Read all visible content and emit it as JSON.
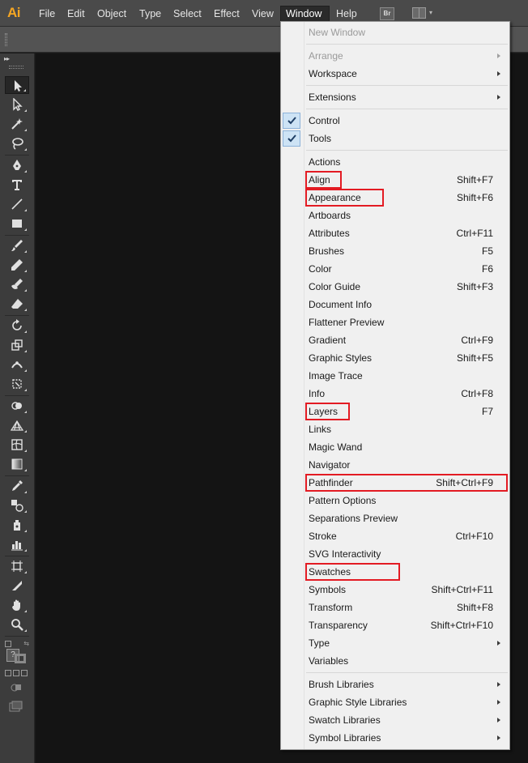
{
  "app": {
    "logo_text": "Ai"
  },
  "menubar": {
    "items": [
      "File",
      "Edit",
      "Object",
      "Type",
      "Select",
      "Effect",
      "View",
      "Window",
      "Help"
    ],
    "active": "Window",
    "bridge_label": "Br"
  },
  "tools": {
    "collapse_label": "▸▸",
    "items": [
      "selection-tool-icon",
      "direct-selection-tool-icon",
      "magic-wand-tool-icon",
      "lasso-tool-icon",
      "pen-tool-icon",
      "type-tool-icon",
      "line-segment-tool-icon",
      "rectangle-tool-icon",
      "paintbrush-tool-icon",
      "pencil-tool-icon",
      "blob-brush-tool-icon",
      "eraser-tool-icon",
      "rotate-tool-icon",
      "scale-tool-icon",
      "width-tool-icon",
      "free-transform-tool-icon",
      "shape-builder-tool-icon",
      "perspective-grid-tool-icon",
      "mesh-tool-icon",
      "gradient-tool-icon",
      "eyedropper-tool-icon",
      "blend-tool-icon",
      "symbol-sprayer-tool-icon",
      "column-graph-tool-icon",
      "artboard-tool-icon",
      "slice-tool-icon",
      "hand-tool-icon",
      "zoom-tool-icon"
    ],
    "fill_stroke_label": "?"
  },
  "window_menu": {
    "accent_check": "#8db2d9",
    "highlight_color": "#e31b23",
    "items": [
      {
        "label": "New Window",
        "shortcut": "",
        "submenu": false,
        "checked": false,
        "disabled": true,
        "highlighted": false
      },
      {
        "sep": true
      },
      {
        "label": "Arrange",
        "shortcut": "",
        "submenu": true,
        "checked": false,
        "disabled": true,
        "highlighted": false
      },
      {
        "label": "Workspace",
        "shortcut": "",
        "submenu": true,
        "checked": false,
        "disabled": false,
        "highlighted": false
      },
      {
        "sep": true
      },
      {
        "label": "Extensions",
        "shortcut": "",
        "submenu": true,
        "checked": false,
        "disabled": false,
        "highlighted": false
      },
      {
        "sep": true
      },
      {
        "label": "Control",
        "shortcut": "",
        "submenu": false,
        "checked": true,
        "disabled": false,
        "highlighted": false
      },
      {
        "label": "Tools",
        "shortcut": "",
        "submenu": false,
        "checked": true,
        "disabled": false,
        "highlighted": false
      },
      {
        "sep": true
      },
      {
        "label": "Actions",
        "shortcut": "",
        "submenu": false,
        "checked": false,
        "disabled": false,
        "highlighted": false
      },
      {
        "label": "Align",
        "shortcut": "Shift+F7",
        "submenu": false,
        "checked": false,
        "disabled": false,
        "highlighted": true
      },
      {
        "label": "Appearance",
        "shortcut": "Shift+F6",
        "submenu": false,
        "checked": false,
        "disabled": false,
        "highlighted": true
      },
      {
        "label": "Artboards",
        "shortcut": "",
        "submenu": false,
        "checked": false,
        "disabled": false,
        "highlighted": false
      },
      {
        "label": "Attributes",
        "shortcut": "Ctrl+F11",
        "submenu": false,
        "checked": false,
        "disabled": false,
        "highlighted": false
      },
      {
        "label": "Brushes",
        "shortcut": "F5",
        "submenu": false,
        "checked": false,
        "disabled": false,
        "highlighted": false
      },
      {
        "label": "Color",
        "shortcut": "F6",
        "submenu": false,
        "checked": false,
        "disabled": false,
        "highlighted": false
      },
      {
        "label": "Color Guide",
        "shortcut": "Shift+F3",
        "submenu": false,
        "checked": false,
        "disabled": false,
        "highlighted": false
      },
      {
        "label": "Document Info",
        "shortcut": "",
        "submenu": false,
        "checked": false,
        "disabled": false,
        "highlighted": false
      },
      {
        "label": "Flattener Preview",
        "shortcut": "",
        "submenu": false,
        "checked": false,
        "disabled": false,
        "highlighted": false
      },
      {
        "label": "Gradient",
        "shortcut": "Ctrl+F9",
        "submenu": false,
        "checked": false,
        "disabled": false,
        "highlighted": false
      },
      {
        "label": "Graphic Styles",
        "shortcut": "Shift+F5",
        "submenu": false,
        "checked": false,
        "disabled": false,
        "highlighted": false
      },
      {
        "label": "Image Trace",
        "shortcut": "",
        "submenu": false,
        "checked": false,
        "disabled": false,
        "highlighted": false
      },
      {
        "label": "Info",
        "shortcut": "Ctrl+F8",
        "submenu": false,
        "checked": false,
        "disabled": false,
        "highlighted": false
      },
      {
        "label": "Layers",
        "shortcut": "F7",
        "submenu": false,
        "checked": false,
        "disabled": false,
        "highlighted": true
      },
      {
        "label": "Links",
        "shortcut": "",
        "submenu": false,
        "checked": false,
        "disabled": false,
        "highlighted": false
      },
      {
        "label": "Magic Wand",
        "shortcut": "",
        "submenu": false,
        "checked": false,
        "disabled": false,
        "highlighted": false
      },
      {
        "label": "Navigator",
        "shortcut": "",
        "submenu": false,
        "checked": false,
        "disabled": false,
        "highlighted": false
      },
      {
        "label": "Pathfinder",
        "shortcut": "Shift+Ctrl+F9",
        "submenu": false,
        "checked": false,
        "disabled": false,
        "highlighted": true
      },
      {
        "label": "Pattern Options",
        "shortcut": "",
        "submenu": false,
        "checked": false,
        "disabled": false,
        "highlighted": false
      },
      {
        "label": "Separations Preview",
        "shortcut": "",
        "submenu": false,
        "checked": false,
        "disabled": false,
        "highlighted": false
      },
      {
        "label": "Stroke",
        "shortcut": "Ctrl+F10",
        "submenu": false,
        "checked": false,
        "disabled": false,
        "highlighted": false
      },
      {
        "label": "SVG Interactivity",
        "shortcut": "",
        "submenu": false,
        "checked": false,
        "disabled": false,
        "highlighted": false
      },
      {
        "label": "Swatches",
        "shortcut": "",
        "submenu": false,
        "checked": false,
        "disabled": false,
        "highlighted": true
      },
      {
        "label": "Symbols",
        "shortcut": "Shift+Ctrl+F11",
        "submenu": false,
        "checked": false,
        "disabled": false,
        "highlighted": false
      },
      {
        "label": "Transform",
        "shortcut": "Shift+F8",
        "submenu": false,
        "checked": false,
        "disabled": false,
        "highlighted": false
      },
      {
        "label": "Transparency",
        "shortcut": "Shift+Ctrl+F10",
        "submenu": false,
        "checked": false,
        "disabled": false,
        "highlighted": false
      },
      {
        "label": "Type",
        "shortcut": "",
        "submenu": true,
        "checked": false,
        "disabled": false,
        "highlighted": false
      },
      {
        "label": "Variables",
        "shortcut": "",
        "submenu": false,
        "checked": false,
        "disabled": false,
        "highlighted": false
      },
      {
        "sep": true
      },
      {
        "label": "Brush Libraries",
        "shortcut": "",
        "submenu": true,
        "checked": false,
        "disabled": false,
        "highlighted": false
      },
      {
        "label": "Graphic Style Libraries",
        "shortcut": "",
        "submenu": true,
        "checked": false,
        "disabled": false,
        "highlighted": false
      },
      {
        "label": "Swatch Libraries",
        "shortcut": "",
        "submenu": true,
        "checked": false,
        "disabled": false,
        "highlighted": false
      },
      {
        "label": "Symbol Libraries",
        "shortcut": "",
        "submenu": true,
        "checked": false,
        "disabled": false,
        "highlighted": false
      }
    ]
  }
}
